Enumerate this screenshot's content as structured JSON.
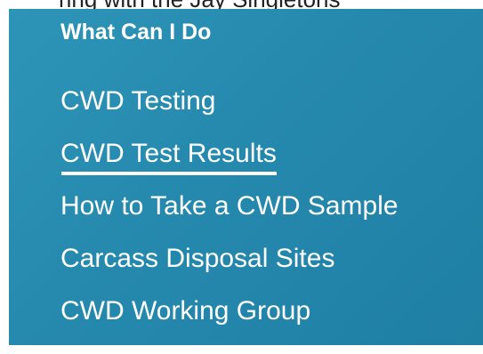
{
  "top_clipped_text": "ring with the Jay Singletons",
  "sidebar": {
    "heading": "What Can I Do",
    "items": [
      {
        "label": "CWD Testing",
        "active": false
      },
      {
        "label": "CWD Test Results",
        "active": true
      },
      {
        "label": "How to Take a CWD Sample",
        "active": false
      },
      {
        "label": "Carcass Disposal Sites",
        "active": false
      },
      {
        "label": "CWD Working Group",
        "active": false
      }
    ]
  },
  "colors": {
    "panel_background": "#2589ad",
    "text": "#ffffff",
    "active_underline": "#ffffff"
  }
}
